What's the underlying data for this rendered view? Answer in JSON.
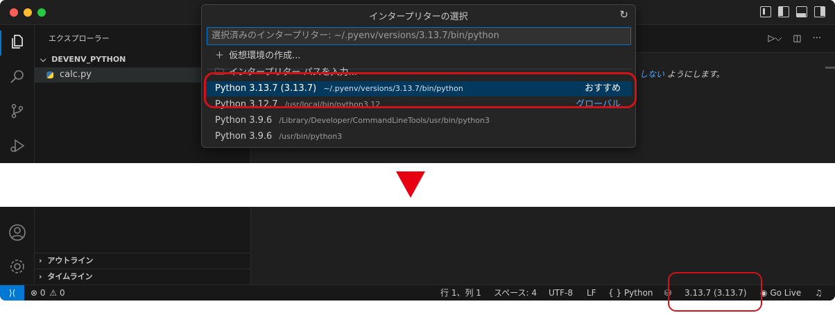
{
  "window": {
    "explorer_title": "エクスプローラー",
    "folder_name": "DEVENV_PYTHON",
    "file_name": "calc.py"
  },
  "editor": {
    "hint_link": "しない",
    "hint_text": "ようにします。"
  },
  "quick_pick": {
    "title": "インタープリターの選択",
    "input_placeholder": "選択済みのインタープリター: ~/.pyenv/versions/3.13.7/bin/python",
    "create_env": "仮想環境の作成...",
    "enter_path": "インタープリター パスを入力...",
    "items": [
      {
        "label": "Python 3.13.7 (3.13.7)",
        "path": "~/.pyenv/versions/3.13.7/bin/python",
        "tag": "おすすめ"
      },
      {
        "label": "Python 3.12.7",
        "path": "/usr/local/bin/python3.12",
        "tag": "グローバル"
      },
      {
        "label": "Python 3.9.6",
        "path": "/Library/Developer/CommandLineTools/usr/bin/python3",
        "tag": ""
      },
      {
        "label": "Python 3.9.6",
        "path": "/usr/bin/python3",
        "tag": ""
      }
    ]
  },
  "bottom": {
    "outline": "アウトライン",
    "timeline": "タイムライン"
  },
  "status": {
    "errors": "0",
    "warnings": "0",
    "position": "行 1、列 1",
    "spaces": "スペース: 4",
    "encoding": "UTF-8",
    "eol": "LF",
    "language": "Python",
    "interpreter": "3.13.7 (3.13.7)",
    "golive": "Go Live"
  },
  "colors": {
    "accent": "#0078d4",
    "highlight": "#d0121b",
    "arrow": "#e60012"
  }
}
